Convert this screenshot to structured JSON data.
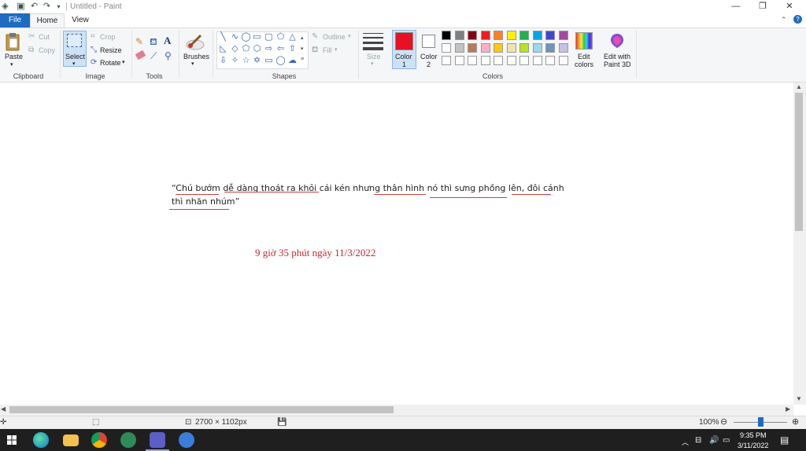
{
  "window": {
    "title": "Untitled - Paint"
  },
  "tabs": {
    "file": "File",
    "home": "Home",
    "view": "View"
  },
  "clipboard": {
    "paste": "Paste",
    "cut": "Cut",
    "copy": "Copy",
    "group": "Clipboard"
  },
  "image": {
    "select": "Select",
    "crop": "Crop",
    "resize": "Resize",
    "rotate": "Rotate",
    "group": "Image"
  },
  "tools": {
    "group": "Tools",
    "text_glyph": "A"
  },
  "brushes": {
    "label": "Brushes"
  },
  "shapes": {
    "outline": "Outline",
    "fill": "Fill",
    "group": "Shapes"
  },
  "size": {
    "label": "Size"
  },
  "colors": {
    "color1_label": "Color",
    "color1_num": "1",
    "color2_label": "Color",
    "color2_num": "2",
    "group": "Colors",
    "edit_colors_line1": "Edit",
    "edit_colors_line2": "colors",
    "edit3d_line1": "Edit with",
    "edit3d_line2": "Paint 3D",
    "color1_value": "#e81123",
    "color2_value": "#ffffff",
    "palette_row1": [
      "#000000",
      "#7f7f7f",
      "#880015",
      "#ed1c24",
      "#ff7f27",
      "#fff200",
      "#22b14c",
      "#00a2e8",
      "#3f48cc",
      "#a349a4"
    ],
    "palette_row2": [
      "#ffffff",
      "#c3c3c3",
      "#b97a57",
      "#ffaec9",
      "#ffc90e",
      "#efe4b0",
      "#b5e61d",
      "#99d9ea",
      "#7092be",
      "#c8bfe7"
    ]
  },
  "canvas": {
    "quote_line1": "“Chú bướm dễ dàng thoát ra khỏi cái kén nhưng thân hình nó thì sưng phồng lên, đôi cánh",
    "quote_line2": "thì nhăn nhúm”",
    "timestamp": "9 giờ 35 phút ngày 11/3/2022"
  },
  "status": {
    "dimensions": "2700 × 1102px",
    "zoom": "100%"
  },
  "taskbar": {
    "time": "9:35 PM",
    "date": "3/11/2022"
  }
}
